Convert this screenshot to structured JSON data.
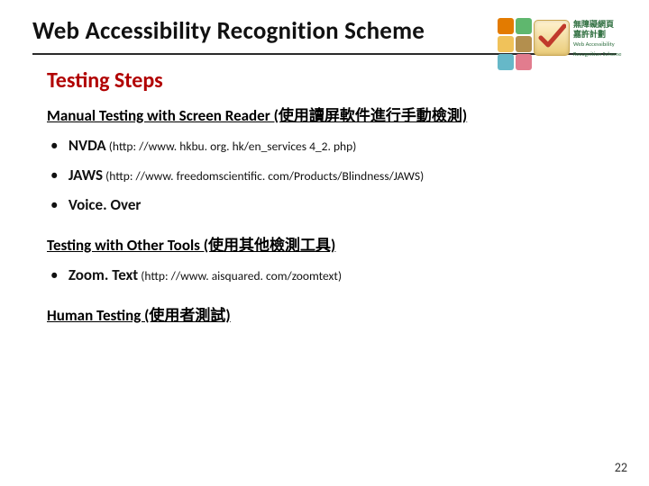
{
  "header": {
    "title": "Web Accessibility Recognition Scheme"
  },
  "logo": {
    "cn_line1": "無障礙網頁",
    "cn_line2": "嘉許計劃",
    "en_line1": "Web Accessibility",
    "en_line2": "Recognition Scheme"
  },
  "section_title": "Testing Steps",
  "sections": [
    {
      "heading": "Manual Testing with Screen Reader (使用讀屏軟件進行手動檢測)",
      "items": [
        {
          "name": "NVDA",
          "detail": " (http: //www. hkbu. org. hk/en_services 4_2. php)"
        },
        {
          "name": "JAWS",
          "detail": " (http: //www. freedomscientific. com/Products/Blindness/JAWS)"
        },
        {
          "name": "Voice. Over",
          "detail": ""
        }
      ]
    },
    {
      "heading": "Testing with Other Tools (使用其他檢測工具)",
      "items": [
        {
          "name": "Zoom. Text",
          "detail": " (http: //www. aisquared. com/zoomtext)"
        }
      ]
    },
    {
      "heading": "Human Testing (使用者測試)",
      "items": []
    }
  ],
  "page_number": "22"
}
